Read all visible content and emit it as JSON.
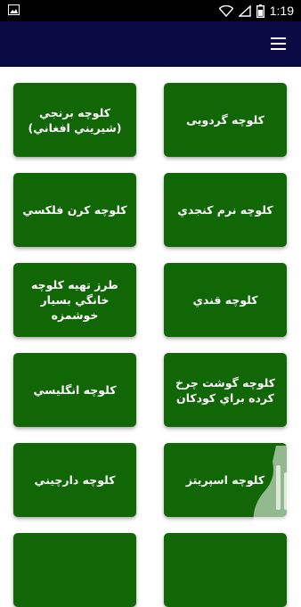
{
  "status_bar": {
    "time": "1:19",
    "icons": [
      "gallery-icon",
      "wifi-icon",
      "signal-icon",
      "battery-icon"
    ]
  },
  "app_bar": {
    "menu_icon": "hamburger-menu-icon",
    "color": "#0a0a45"
  },
  "items": [
    {
      "label": "کلوچه گردویی"
    },
    {
      "label": "کلوچه برنجي (شيريني افغاني)"
    },
    {
      "label": "کلوچه نرم کنجدي"
    },
    {
      "label": "کلوچه کرن فلکسي"
    },
    {
      "label": "کلوچه قندي"
    },
    {
      "label": "طرز تهيه کلوچه خانگي بسيار خوشمزه"
    },
    {
      "label": "کلوچه گوشت چرخ کرده براي کودکان"
    },
    {
      "label": "کلوچه انگليسي"
    },
    {
      "label": "کلوچه اسپريتز"
    },
    {
      "label": "کلوچه دارچيني"
    }
  ],
  "colors": {
    "card": "#116606",
    "card_text": "#ffffff",
    "background": "#ffffff"
  }
}
